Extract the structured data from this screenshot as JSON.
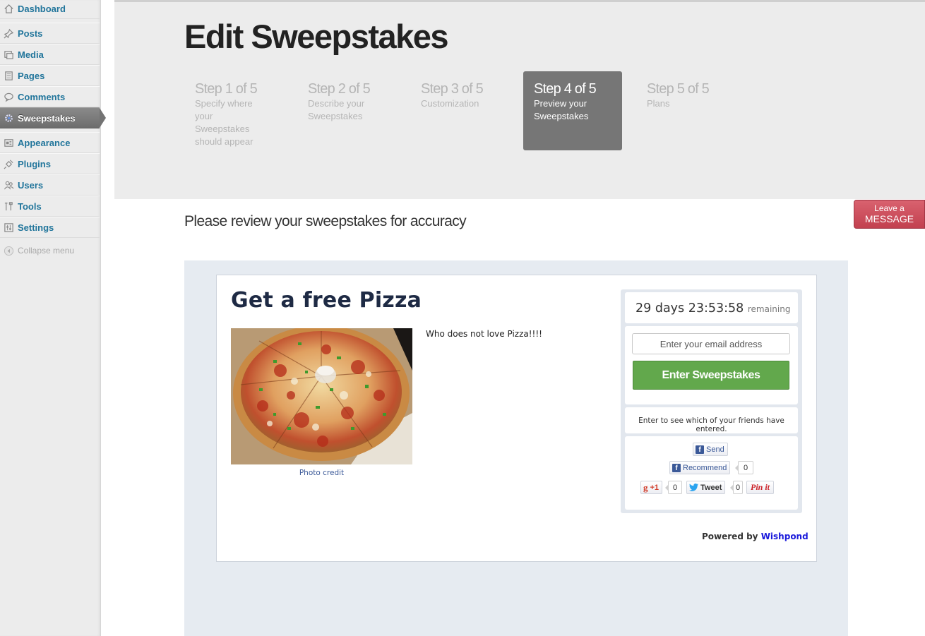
{
  "sidebar": {
    "items": [
      {
        "label": "Dashboard",
        "icon": "dashboard-icon"
      },
      {
        "label": "Posts",
        "icon": "pushpin-icon"
      },
      {
        "label": "Media",
        "icon": "media-icon"
      },
      {
        "label": "Pages",
        "icon": "pages-icon"
      },
      {
        "label": "Comments",
        "icon": "comment-icon"
      },
      {
        "label": "Sweepstakes",
        "icon": "gear-icon",
        "active": true
      },
      {
        "label": "Appearance",
        "icon": "appearance-icon"
      },
      {
        "label": "Plugins",
        "icon": "plug-icon"
      },
      {
        "label": "Users",
        "icon": "users-icon"
      },
      {
        "label": "Tools",
        "icon": "tools-icon"
      },
      {
        "label": "Settings",
        "icon": "settings-icon"
      }
    ],
    "collapse_label": "Collapse menu"
  },
  "header": {
    "title": "Edit Sweepstakes",
    "steps": [
      {
        "head": "Step 1 of 5",
        "desc": "Specify where your Sweepstakes should appear"
      },
      {
        "head": "Step 2 of 5",
        "desc": "Describe your Sweepstakes"
      },
      {
        "head": "Step 3 of 5",
        "desc": "Customization"
      },
      {
        "head": "Step 4 of 5",
        "desc": "Preview your Sweepstakes",
        "current": true
      },
      {
        "head": "Step 5 of 5",
        "desc": "Plans"
      }
    ]
  },
  "review_title": "Please review your sweepstakes for accuracy",
  "leave_message": {
    "line1": "Leave a",
    "line2": "MESSAGE"
  },
  "preview": {
    "title": "Get a free Pizza",
    "description": "Who does not love Pizza!!!!",
    "photo_credit": "Photo credit",
    "timer": {
      "value": "29 days 23:53:58",
      "suffix": "remaining"
    },
    "email_placeholder": "Enter your email address",
    "enter_button": "Enter Sweepstakes",
    "friends_text": "Enter to see which of your friends have entered.",
    "social": {
      "send": "Send",
      "recommend": "Recommend",
      "recommend_count": "0",
      "gplus": "+1",
      "gplus_count": "0",
      "tweet": "Tweet",
      "tweet_count": "0",
      "pinit": "Pin it"
    },
    "powered_by": "Powered by",
    "powered_brand": "Wishpond"
  },
  "colors": {
    "wp_link": "#21759b",
    "active_menu": "#767676",
    "enter_button": "#62a84c",
    "leave_message": "#c2404f",
    "preview_bg": "#e6ebf1"
  }
}
